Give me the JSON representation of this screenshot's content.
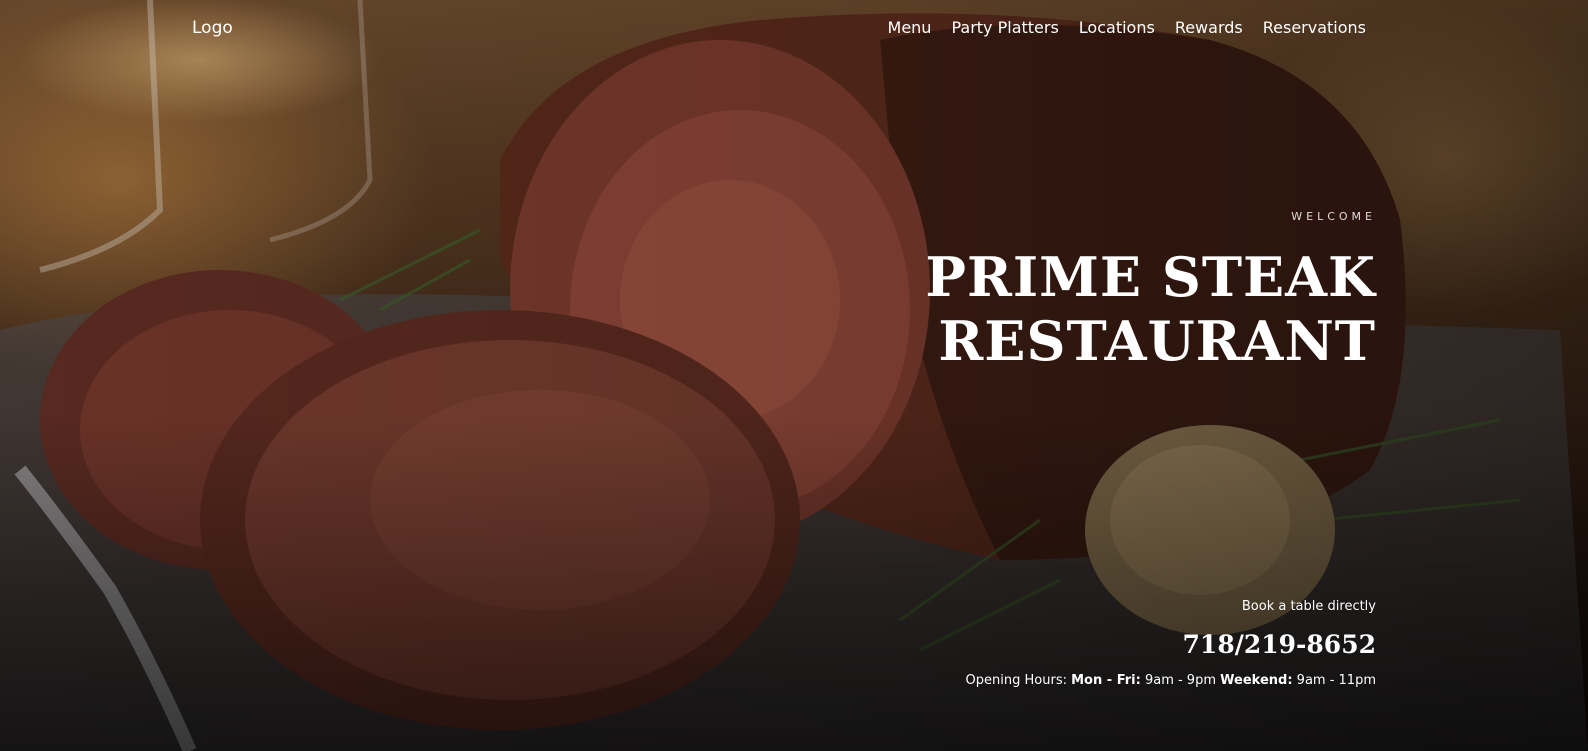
{
  "nav": {
    "logo": "Logo",
    "items": [
      "Menu",
      "Party Platters",
      "Locations",
      "Rewards",
      "Reservations"
    ]
  },
  "hero": {
    "eyebrow": "WELCOME",
    "title_line1": "PRIME STEAK",
    "title_line2": "RESTAURANT",
    "book_label": "Book a table directly",
    "phone": "718/219-8652",
    "hours": {
      "prefix": "Opening Hours:",
      "weekday_label": "Mon - Fri:",
      "weekday_hours": "9am - 9pm",
      "weekend_label": "Weekend:",
      "weekend_hours": "9am - 11pm"
    }
  }
}
